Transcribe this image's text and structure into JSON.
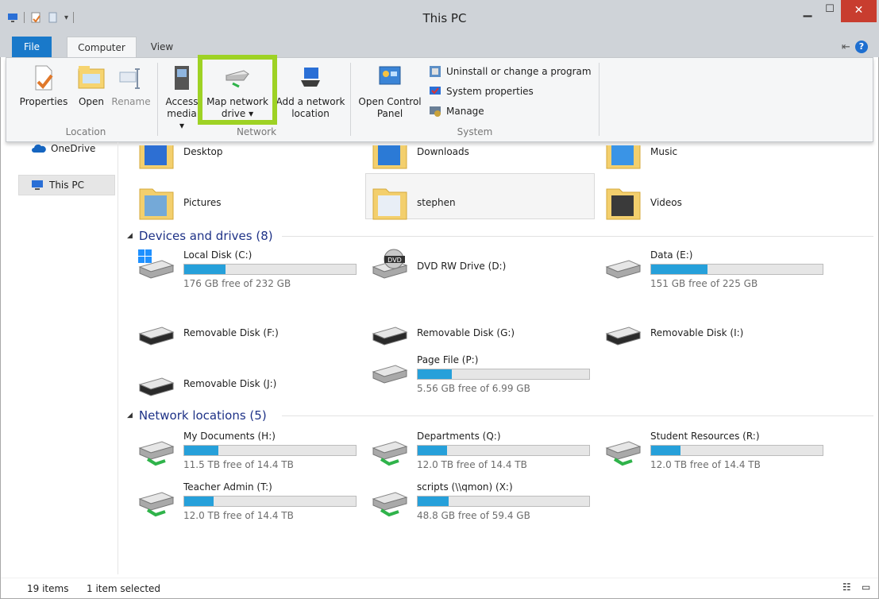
{
  "window": {
    "title": "This PC"
  },
  "tabs": {
    "file": "File",
    "computer": "Computer",
    "view": "View"
  },
  "ribbon": {
    "properties": "Properties",
    "open": "Open",
    "rename": "Rename",
    "location_group": "Location",
    "access_media_1": "Access",
    "access_media_2": "media ▾",
    "map_drive_1": "Map network",
    "map_drive_2": "drive ▾",
    "add_location_1": "Add a network",
    "add_location_2": "location",
    "network_group": "Network",
    "open_cp_1": "Open Control",
    "open_cp_2": "Panel",
    "uninstall": "Uninstall or change a program",
    "system_props": "System properties",
    "manage": "Manage",
    "system_group": "System"
  },
  "nav": {
    "onedrive": "OneDrive",
    "thispc": "This PC"
  },
  "folders": [
    "Desktop",
    "Downloads",
    "Music",
    "Pictures",
    "stephen",
    "Videos"
  ],
  "devices": {
    "header": "Devices and drives (8)",
    "items": [
      {
        "name": "Local Disk (C:)",
        "free": "176 GB free of 232 GB",
        "used": 0.24
      },
      {
        "name": "DVD RW Drive (D:)"
      },
      {
        "name": "Data (E:)",
        "free": "151 GB free of 225 GB",
        "used": 0.33
      },
      {
        "name": "Removable Disk (F:)"
      },
      {
        "name": "Removable Disk (G:)"
      },
      {
        "name": "Removable Disk (I:)"
      },
      {
        "name": "Removable Disk (J:)"
      },
      {
        "name": "Page File (P:)",
        "free": "5.56 GB free of 6.99 GB",
        "used": 0.2
      }
    ]
  },
  "network": {
    "header": "Network locations (5)",
    "items": [
      {
        "name": "My Documents (H:)",
        "free": "11.5 TB free of 14.4 TB",
        "used": 0.2
      },
      {
        "name": "Departments (Q:)",
        "free": "12.0 TB free of 14.4 TB",
        "used": 0.17
      },
      {
        "name": "Student Resources (R:)",
        "free": "12.0 TB free of 14.4 TB",
        "used": 0.17
      },
      {
        "name": "Teacher Admin (T:)",
        "free": "12.0 TB free of 14.4 TB",
        "used": 0.17
      },
      {
        "name": "scripts (\\\\qmon) (X:)",
        "free": "48.8 GB free of 59.4 GB",
        "used": 0.18
      }
    ]
  },
  "status": {
    "count": "19 items",
    "selected": "1 item selected"
  }
}
